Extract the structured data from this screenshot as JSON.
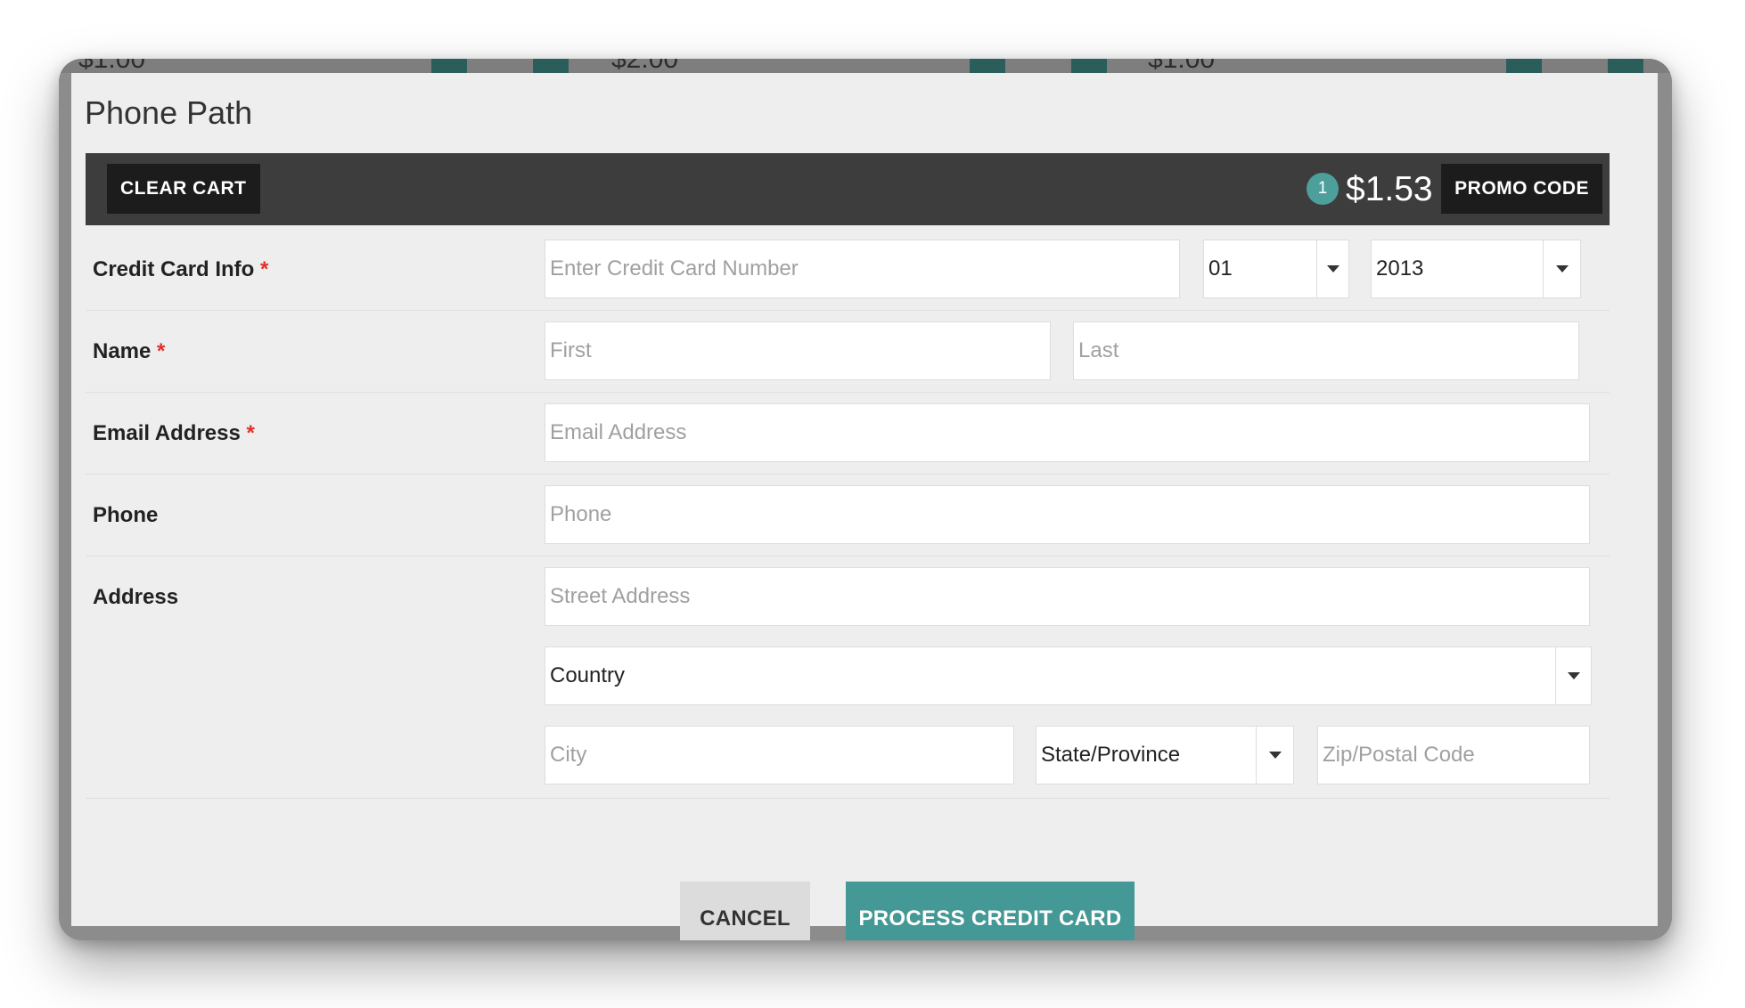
{
  "background": {
    "prices": [
      "$1.00",
      "$2.00",
      "$1.00"
    ],
    "colors": {
      "frame": "#8c8c8c",
      "tile_accent": "#2b5e5b"
    }
  },
  "dialog": {
    "title": "Phone Path"
  },
  "cart": {
    "clear_label": "CLEAR CART",
    "item_count": "1",
    "total": "$1.53",
    "promo_label": "PROMO CODE"
  },
  "form": {
    "credit_card": {
      "label": "Credit Card Info",
      "required_marker": "*",
      "number_placeholder": "Enter Credit Card Number",
      "month_value": "01",
      "year_value": "2013"
    },
    "name": {
      "label": "Name",
      "required_marker": "*",
      "first_placeholder": "First",
      "last_placeholder": "Last"
    },
    "email": {
      "label": "Email Address",
      "required_marker": "*",
      "placeholder": "Email Address"
    },
    "phone": {
      "label": "Phone",
      "placeholder": "Phone"
    },
    "address": {
      "label": "Address",
      "street_placeholder": "Street Address",
      "country_value": "Country",
      "city_placeholder": "City",
      "state_value": "State/Province",
      "zip_placeholder": "Zip/Postal Code"
    }
  },
  "actions": {
    "cancel_label": "CANCEL",
    "process_label": "PROCESS CREDIT CARD"
  },
  "colors": {
    "accent": "#449895",
    "badge": "#4d9f9c",
    "cart_bar": "#3d3d3d",
    "dark_button": "#1c1c1c",
    "required": "#e0302a",
    "dialog_bg": "#eeeeee"
  }
}
